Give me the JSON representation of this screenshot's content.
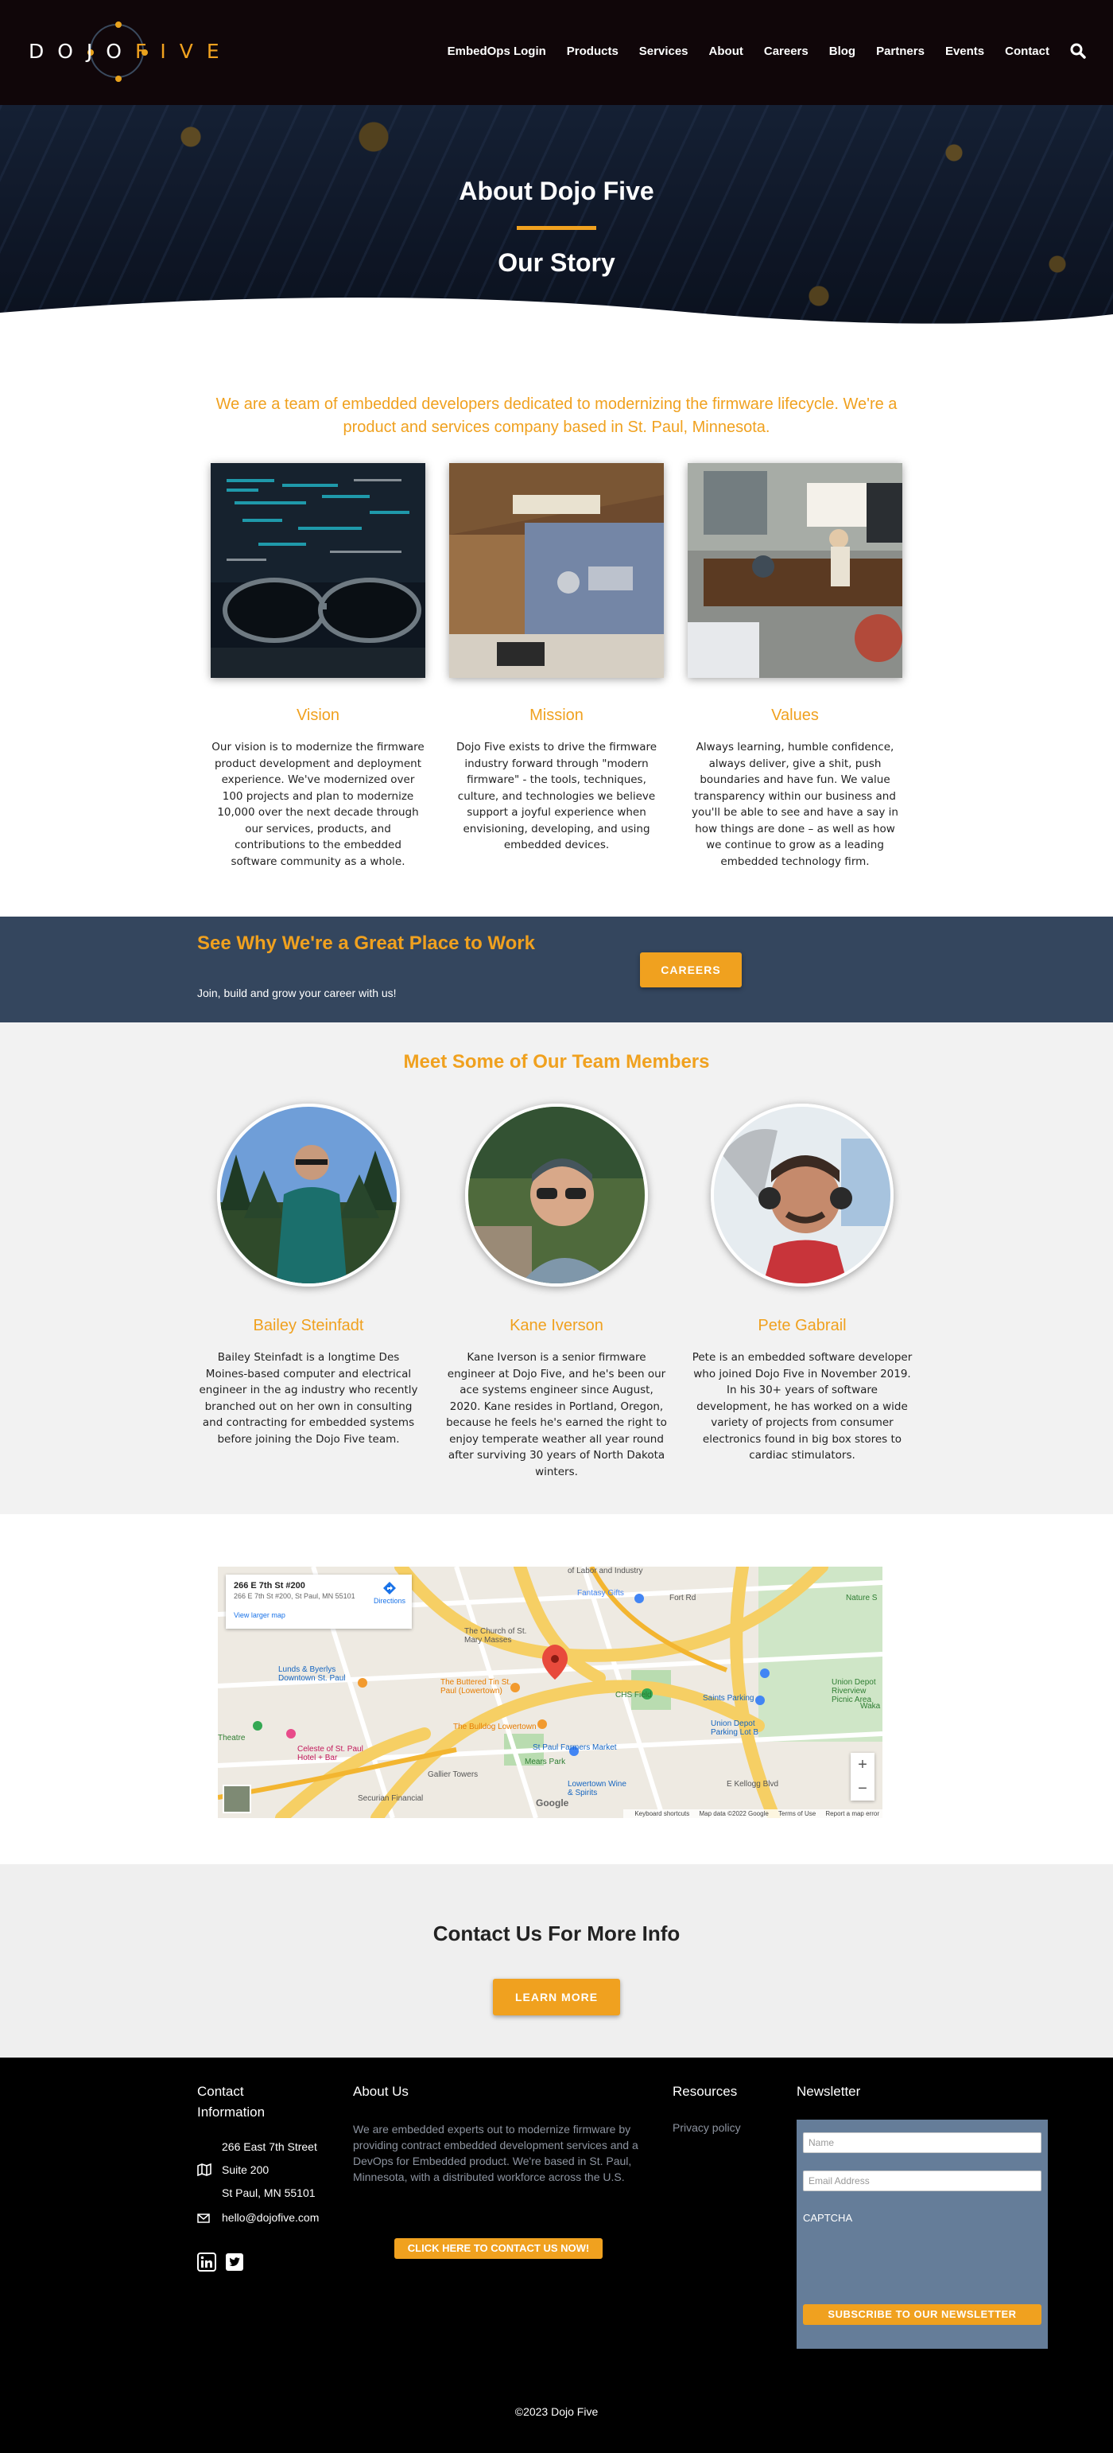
{
  "brand": {
    "logo_word1": "DOJO",
    "logo_word2": "FIVE",
    "accent_color": "#f0a11f",
    "header_bg": "#100609",
    "band_color": "#34465e"
  },
  "nav": {
    "items": [
      "EmbedOps Login",
      "Products",
      "Services",
      "About",
      "Careers",
      "Blog",
      "Partners",
      "Events",
      "Contact"
    ],
    "search_icon": "search-icon"
  },
  "hero": {
    "title": "About Dojo Five",
    "subtitle": "Our Story"
  },
  "intro": {
    "lead": "We are a team of embedded developers dedicated to modernizing the firmware lifecycle. We're a product and services company based in St. Paul, Minnesota.",
    "pillars": [
      {
        "title": "Vision",
        "text": "Our vision is to modernize the firmware product development and deployment experience. We've modernized over 100 projects and plan to modernize 10,000 over the next decade through our services, products, and contributions to the embedded software community as a whole."
      },
      {
        "title": "Mission",
        "text": "Dojo Five exists to drive the firmware industry forward through \"modern firmware\" - the tools, techniques, culture, and technologies we believe support a joyful experience when envisioning, developing, and using embedded devices."
      },
      {
        "title": "Values",
        "text": "Always learning, humble confidence, always deliver, give a shit, push boundaries and have fun. We value transparency within our business and you'll be able to see and have a say in how things are done – as well as how we continue to grow as a leading embedded technology firm."
      }
    ]
  },
  "careers": {
    "title": "See Why We're a Great Place to Work",
    "subtitle": "Join, build and grow your career with us!",
    "button": "CAREERS"
  },
  "team": {
    "title": "Meet Some of Our Team Members",
    "members": [
      {
        "name": "Bailey Steinfadt",
        "bio": "Bailey Steinfadt is a longtime Des Moines-based computer and electrical engineer in the ag industry who recently branched out on her own in consulting and contracting for embedded systems before joining the Dojo Five team."
      },
      {
        "name": "Kane Iverson",
        "bio": "Kane Iverson is a senior firmware engineer at Dojo Five, and he's been our ace systems engineer since August, 2020. Kane resides in Portland, Oregon, because he feels he's earned the right to enjoy temperate weather all year round after surviving 30 years of North Dakota winters."
      },
      {
        "name": "Pete Gabrail",
        "bio": "Pete is an embedded software developer who joined Dojo Five in November 2019. In his 30+ years of software development, he has worked on a wide variety of projects from consumer electronics found in big box stores to cardiac stimulators."
      }
    ]
  },
  "map": {
    "card_title": "266 E 7th St #200",
    "card_address": "266 E 7th St #200, St Paul, MN 55101",
    "card_link": "View larger map",
    "directions": "Directions",
    "labels": {
      "labor": "of Labor and Industry",
      "fantasy": "Fantasy Gifts",
      "fortrd": "Fort Rd",
      "nature": "Nature S",
      "church": "The Church of St. Mary Masses",
      "lunds": "Lunds & Byerlys Downtown St. Paul",
      "buttered": "The Buttered Tin St. Paul (Lowertown)",
      "chs": "CHS Field",
      "saints": "Saints Parking",
      "union": "Union Depot Parking Lot B",
      "uniondepot": "Union Depot Riverview Picnic Area",
      "bulldog": "The Bulldog Lowertown",
      "farmers": "St Paul Farmers Market",
      "mears": "Mears Park",
      "theatre": "Theatre",
      "celeste": "Celeste of St. Paul Hotel + Bar",
      "gallier": "Gallier Towers",
      "lowertown_wine": "Lowertown Wine & Spirits",
      "securian": "Securian Financial",
      "kellogg": "E Kellogg Blvd",
      "wakan": "Waka",
      "google": "Google"
    },
    "footer": [
      "Keyboard shortcuts",
      "Map data ©2022 Google",
      "Terms of Use",
      "Report a map error"
    ],
    "zoom_in": "+",
    "zoom_out": "−"
  },
  "contact": {
    "title": "Contact Us For More Info",
    "button": "LEARN MORE"
  },
  "footer": {
    "contact_heading": "Contact Information",
    "address_line1": "266 East 7th Street",
    "address_line2": "Suite 200",
    "address_line3": "St Paul, MN 55101",
    "email": "hello@dojofive.com",
    "about_heading": "About Us",
    "about_text": "We are embedded experts out to modernize firmware by providing contract embedded development services and a DevOps for Embedded product. We're based in St. Paul, Minnesota, with a distributed workforce across the U.S.",
    "cta_button": "CLICK HERE TO CONTACT US NOW!",
    "resources_heading": "Resources",
    "privacy_link": "Privacy policy",
    "newsletter_heading": "Newsletter",
    "name_placeholder": "Name",
    "email_placeholder": "Email Address",
    "captcha": "CAPTCHA",
    "subscribe_button": "SUBSCRIBE TO OUR NEWSLETTER",
    "copyright": "©2023 Dojo Five"
  }
}
